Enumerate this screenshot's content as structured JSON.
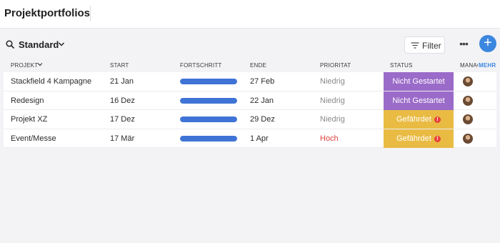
{
  "header": {
    "title": "Projektportfolios"
  },
  "toolbar": {
    "view_name": "Standard",
    "filter_label": "Filter",
    "more_label": "•••",
    "add_label": "+"
  },
  "columns": {
    "project": "PROJEKT",
    "start": "START",
    "progress": "FORTSCHRITT",
    "end": "ENDE",
    "priority": "PRIORITAT",
    "status": "STATUS",
    "manager": "MANAGER",
    "more": "MEHR"
  },
  "colors": {
    "accent": "#3b87e0",
    "progress": "#3f74d6",
    "status_not_started": "#9b6bc9",
    "status_at_risk": "#e9bb43",
    "priority_high": "#e0413a"
  },
  "rows": [
    {
      "project": "Stackfield 4 Kampagne",
      "start": "21 Jan",
      "progress": 1.0,
      "end": "27 Feb",
      "priority": "Niedrig",
      "status": "Nicht Gestartet",
      "status_type": "not_started"
    },
    {
      "project": "Redesign",
      "start": "16 Dez",
      "progress": 1.0,
      "end": "22 Jan",
      "priority": "Niedrig",
      "status": "Nicht Gestartet",
      "status_type": "not_started"
    },
    {
      "project": "Projekt XZ",
      "start": "17 Dez",
      "progress": 1.0,
      "end": "29 Dez",
      "priority": "Niedrig",
      "status": "Gefährdet",
      "status_type": "at_risk"
    },
    {
      "project": "Event/Messe",
      "start": "17 Mär",
      "progress": 1.0,
      "end": "1 Apr",
      "priority": "Hoch",
      "status": "Gefährdet",
      "status_type": "at_risk"
    }
  ]
}
